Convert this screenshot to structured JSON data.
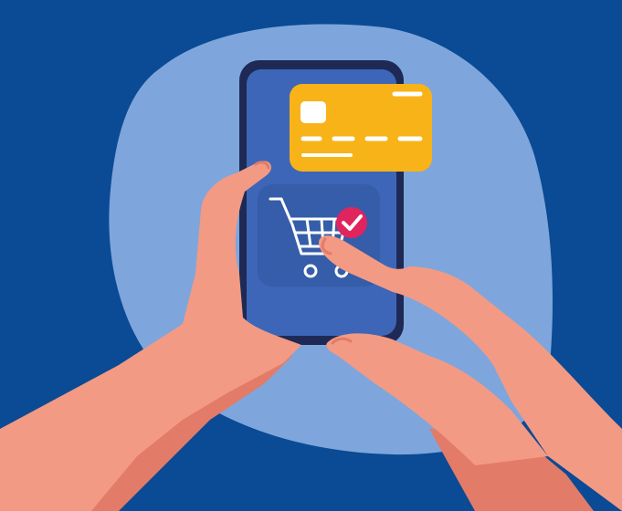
{
  "scene": {
    "description_visible_text": "",
    "icons": [
      "credit-card-icon",
      "shopping-cart-icon",
      "checkmark-icon"
    ],
    "colors": {
      "background": "#0b4a94",
      "blob": "#7ea6dc",
      "phone_body": "#1e2a55",
      "phone_screen": "#3d66b8",
      "screen_tile": "#355da9",
      "card": "#f7b318",
      "skin": "#f39a84",
      "skin_shadow": "#e27b68",
      "check_badge": "#e0245e",
      "white": "#ffffff"
    }
  }
}
